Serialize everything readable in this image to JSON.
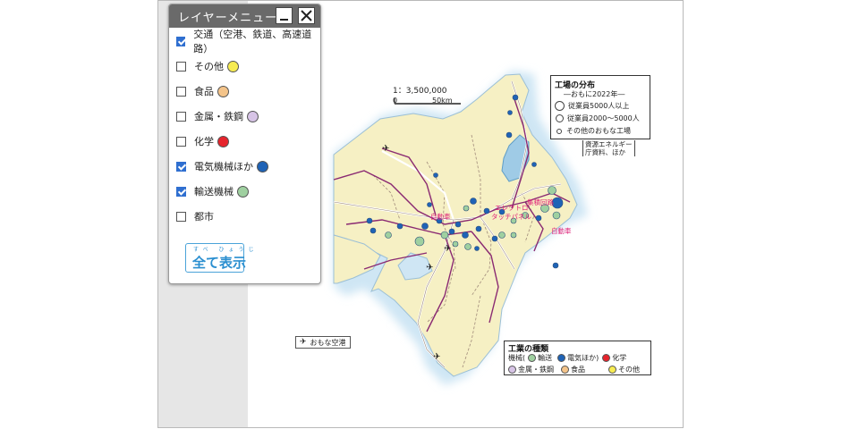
{
  "menu": {
    "title": "レイヤーメニュー",
    "layers": [
      {
        "label": "交通（空港、鉄道、高速道路）",
        "checked": true,
        "swatch": ""
      },
      {
        "label": "その他",
        "checked": false,
        "swatch": "#f7ec52"
      },
      {
        "label": "食品",
        "checked": false,
        "swatch": "#f4c48a"
      },
      {
        "label": "金属・鉄鋼",
        "checked": false,
        "swatch": "#d7c4e6"
      },
      {
        "label": "化学",
        "checked": false,
        "swatch": "#e6242c"
      },
      {
        "label": "電気機械ほか",
        "checked": true,
        "swatch": "#1f63b6"
      },
      {
        "label": "輸送機械",
        "checked": true,
        "swatch": "#9fd0a0"
      },
      {
        "label": "都市",
        "checked": false,
        "swatch": ""
      }
    ],
    "show_all_ruby": "すべ ひょうじ",
    "show_all_label": "全て表示"
  },
  "scale": {
    "ratio": "1：3,500,000",
    "zero": "0",
    "km": "50km"
  },
  "distribution_legend": {
    "title": "工場の分布",
    "subtitle": "―おもに2022年―",
    "items": [
      {
        "label": "従業員5000人以上",
        "size": "large"
      },
      {
        "label": "従業員2000～5000人",
        "size": "medium"
      },
      {
        "label": "その他のおもな工場",
        "size": "small"
      }
    ]
  },
  "source_note": {
    "line1": "資源エネルギー",
    "line2": "庁資料、ほか"
  },
  "type_legend": {
    "title": "工業の種類",
    "machinery_prefix": "機械(",
    "items": [
      {
        "label": "輸送",
        "color": "#9fd0a0"
      },
      {
        "label": "電気ほか)",
        "color": "#1f63b6"
      },
      {
        "label": "化学",
        "color": "#e6242c"
      },
      {
        "label": "金属・鉄鋼",
        "color": "#d7c4e6"
      },
      {
        "label": "食品",
        "color": "#f4c48a"
      },
      {
        "label": "その他",
        "color": "#f7ec52"
      }
    ]
  },
  "airport_legend": {
    "icon": "airplane-icon",
    "label": "おもな空港"
  },
  "map_labels": {
    "auto_west": "自動車",
    "auto_east": "自動車",
    "integrated_circuit": "集積回路",
    "electronics_1": "エレクトロ",
    "electronics_2": "タッチパネル"
  },
  "colors": {
    "land": "#f6f0c4",
    "sea_glow": "#cfe6f4",
    "lake": "#9fcbe6",
    "railway": "#ffffff",
    "expressway": "#8a2a72"
  }
}
